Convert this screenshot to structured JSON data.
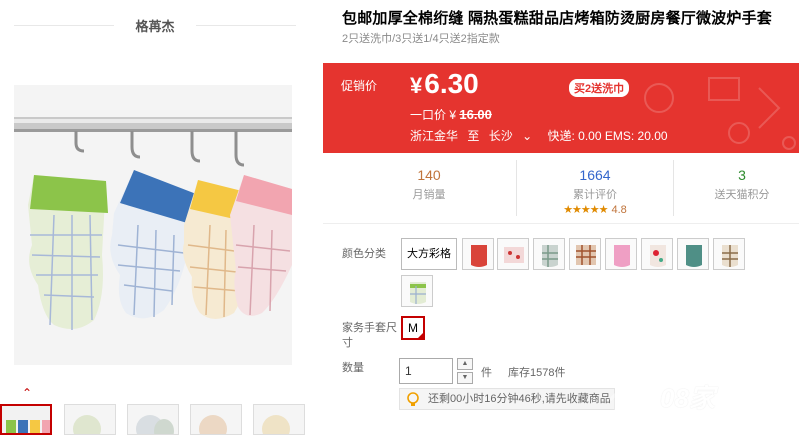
{
  "shop": {
    "name": "格苒杰"
  },
  "product": {
    "title": "包邮加厚全棉绗缝 隔热蛋糕甜品店烤箱防烫厨房餐厅微波炉手套",
    "subtitle": "2只送洗巾/3只送1/4只送2指定款"
  },
  "price_panel": {
    "promo_label": "促销价",
    "currency": "¥",
    "price": "6.30",
    "promo_tag": "买2送洗巾",
    "original_label": "一口价 ¥",
    "original_price": "16.00",
    "origin": "浙江金华",
    "to_label": "至",
    "destination": "长沙",
    "shipping": "快递: 0.00 EMS: 20.00"
  },
  "stats": {
    "monthly_sales": {
      "value": "140",
      "label": "月销量"
    },
    "reviews": {
      "value": "1664",
      "label": "累计评价",
      "stars": "★★★★★",
      "score": "4.8"
    },
    "points": {
      "value": "3",
      "label": "送天猫积分"
    }
  },
  "options": {
    "color_label": "颜色分类",
    "color_text_option": "大方彩格",
    "color_swatch_names": [
      "red",
      "red-dots",
      "grey-check",
      "brown-check",
      "pink",
      "red-pattern",
      "teal",
      "beige-check",
      "green-check"
    ],
    "size_label": "家务手套尺寸",
    "size_value": "M",
    "qty_label": "数量",
    "qty_value": "1",
    "qty_unit": "件",
    "stock": "库存1578件",
    "countdown": "还剩00小时16分钟46秒,请先收藏商品"
  },
  "colors": {
    "accent": "#e5342f",
    "brand_red": "#c40000"
  },
  "watermark": {
    "text": "08家"
  }
}
